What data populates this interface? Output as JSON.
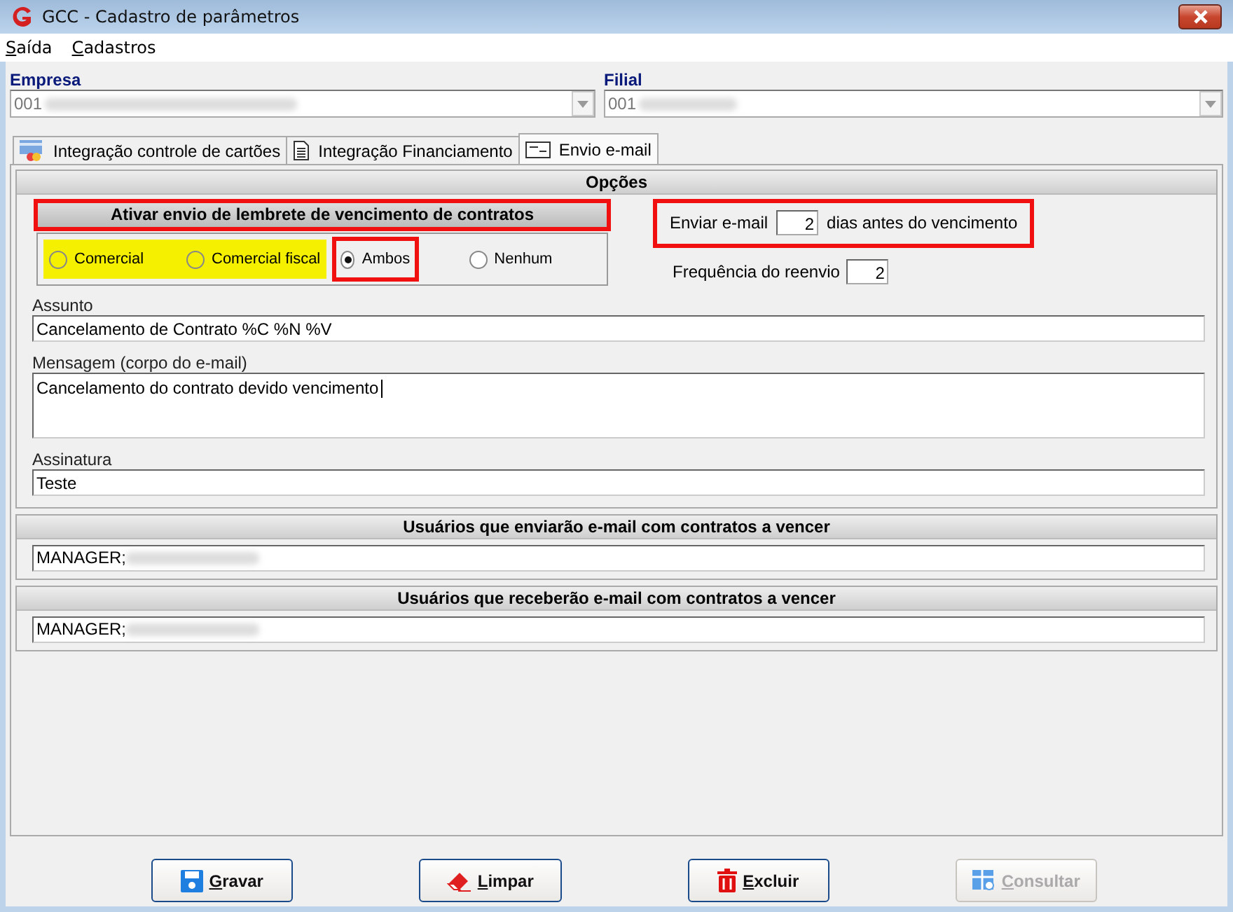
{
  "window": {
    "title": "GCC - Cadastro de parâmetros"
  },
  "menu": [
    {
      "label": "Saída"
    },
    {
      "label": "Cadastros"
    }
  ],
  "empresa": {
    "label": "Empresa",
    "value": "001",
    "disabled": true
  },
  "filial": {
    "label": "Filial",
    "value": "001",
    "disabled": true
  },
  "tabs": [
    {
      "label": "Integração controle de cartões",
      "kind": "card",
      "selected": false
    },
    {
      "label": "Integração Financiamento",
      "kind": "document",
      "selected": false
    },
    {
      "label": "Envio e-mail",
      "kind": "envelope",
      "selected": true
    }
  ],
  "options": {
    "title": "Opções",
    "reminder": {
      "title": "Ativar envio de lembrete de vencimento de contratos",
      "outlined": true,
      "radios": [
        {
          "label": "Comercial",
          "selected": false,
          "highlighted": true,
          "outlined": false
        },
        {
          "label": "Comercial fiscal",
          "selected": false,
          "highlighted": true,
          "outlined": false
        },
        {
          "label": "Ambos",
          "selected": true,
          "highlighted": false,
          "outlined": true
        },
        {
          "label": "Nenhum",
          "selected": false,
          "highlighted": false,
          "outlined": false
        }
      ]
    },
    "send": {
      "label_before": "Enviar e-mail",
      "value": "2",
      "label_after": "dias antes do vencimento",
      "outlined": true
    },
    "resend": {
      "label": "Frequência do reenvio",
      "value": "2"
    },
    "subject": {
      "label": "Assunto",
      "value": "Cancelamento de Contrato %C %N %V"
    },
    "message": {
      "label": "Mensagem (corpo do e-mail)",
      "value": "Cancelamento do contrato devido vencimento"
    },
    "signature": {
      "label": "Assinatura",
      "value": "Teste"
    }
  },
  "senders": {
    "title": "Usuários que enviarão e-mail com contratos a vencer",
    "value": "MANAGER;"
  },
  "receivers": {
    "title": "Usuários que receberão e-mail com contratos a vencer",
    "value": "MANAGER;"
  },
  "buttons": [
    {
      "label": "Gravar",
      "kind": "save",
      "disabled": false
    },
    {
      "label": "Limpar",
      "kind": "eraser",
      "disabled": false
    },
    {
      "label": "Excluir",
      "kind": "trash",
      "disabled": false
    },
    {
      "label": "Consultar",
      "kind": "grid",
      "disabled": true
    }
  ]
}
